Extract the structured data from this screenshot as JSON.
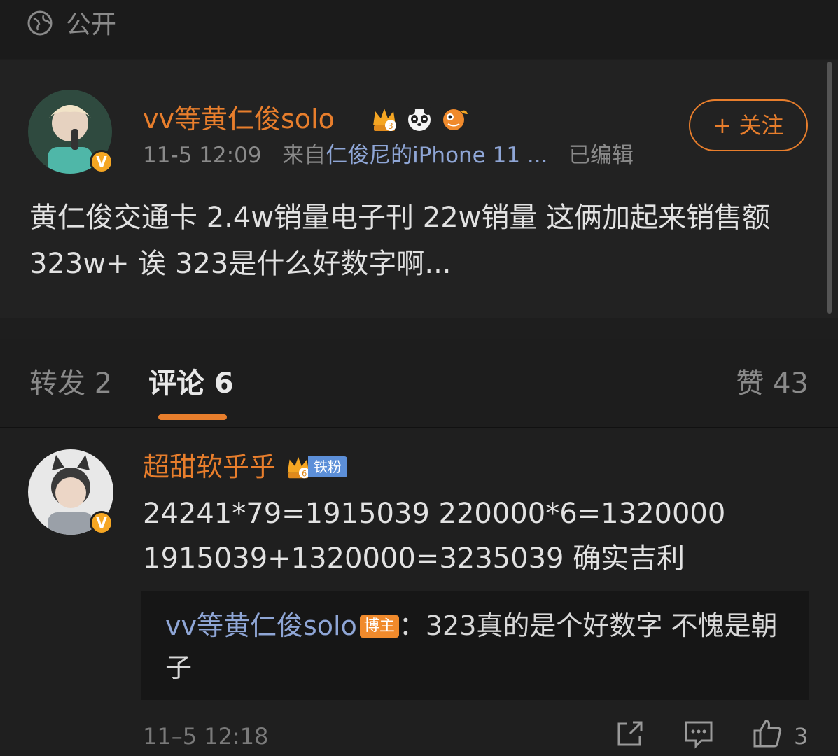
{
  "visibility": {
    "label": "公开",
    "icon": "globe-icon"
  },
  "post": {
    "author": "vv等黄仁俊solo",
    "time": "11-5 12:09",
    "source_prefix": "来自",
    "source": "仁俊尼的iPhone 11 ...",
    "edited": "已编辑",
    "follow_label": "+ 关注",
    "text": "黄仁俊交通卡 2.4w销量电子刊 22w销量 这俩加起来销售额 323w+ 诶 323是什么好数字啊...",
    "verified_badge": "V"
  },
  "tabs": {
    "repost": "转发 2",
    "comment": "评论 6",
    "like": "赞 43"
  },
  "comment": {
    "author": "超甜软乎乎",
    "fan_tag": "铁粉",
    "fan_level": "6",
    "verified_badge": "V",
    "text": "24241*79=1915039 220000*6=1320000 1915039+1320000=3235039 确实吉利",
    "reply": {
      "author": "vv等黄仁俊solo",
      "host_tag": "博主",
      "separator": "：",
      "text": "323真的是个好数字 不愧是朝子"
    },
    "time": "11–5 12:18",
    "like_count": "3"
  },
  "colors": {
    "accent": "#e87e2c",
    "link": "#8fa6d6",
    "badge_gold": "#f5a623"
  }
}
